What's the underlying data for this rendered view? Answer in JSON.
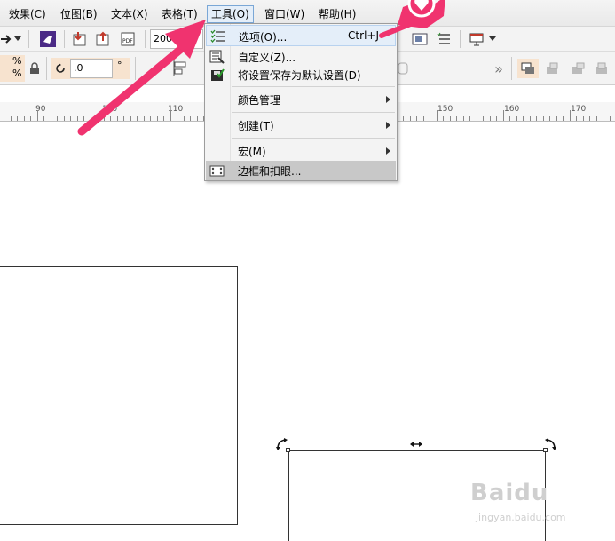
{
  "menubar": {
    "items": [
      {
        "label": "效果(C)"
      },
      {
        "label": "位图(B)"
      },
      {
        "label": "文本(X)"
      },
      {
        "label": "表格(T)"
      },
      {
        "label": "工具(O)"
      },
      {
        "label": "窗口(W)"
      },
      {
        "label": "帮助(H)"
      }
    ],
    "active_index": 4
  },
  "toolbar": {
    "zoom_value": "200",
    "angle_value": ".0",
    "degree_symbol": "°",
    "percent_symbol": "%",
    "more_symbol": "»"
  },
  "ruler": {
    "labels": [
      "90",
      "100",
      "110",
      "150",
      "160",
      "170"
    ]
  },
  "tools_menu": {
    "items": [
      {
        "label": "选项(O)...",
        "shortcut": "Ctrl+J",
        "icon": "options-icon"
      },
      {
        "label": "自定义(Z)...",
        "icon": "customize-icon"
      },
      {
        "label": "将设置保存为默认设置(D)",
        "icon": "save-settings-icon"
      },
      {
        "label": "颜色管理",
        "icon": "",
        "submenu": true
      },
      {
        "label": "创建(T)",
        "icon": "",
        "submenu": true
      },
      {
        "label": "宏(M)",
        "icon": "",
        "submenu": true
      },
      {
        "label": "边框和扣眼...",
        "icon": "border-grommet-icon"
      }
    ]
  },
  "watermark": {
    "brand": "Baidu",
    "sub": "jingyan.baidu.com"
  },
  "colors": {
    "annotation_arrow": "#f0336f",
    "menu_highlight": "#e4eef9",
    "menu_highlight_border": "#7aa7d6",
    "hover_gray": "#c8c8c8"
  }
}
